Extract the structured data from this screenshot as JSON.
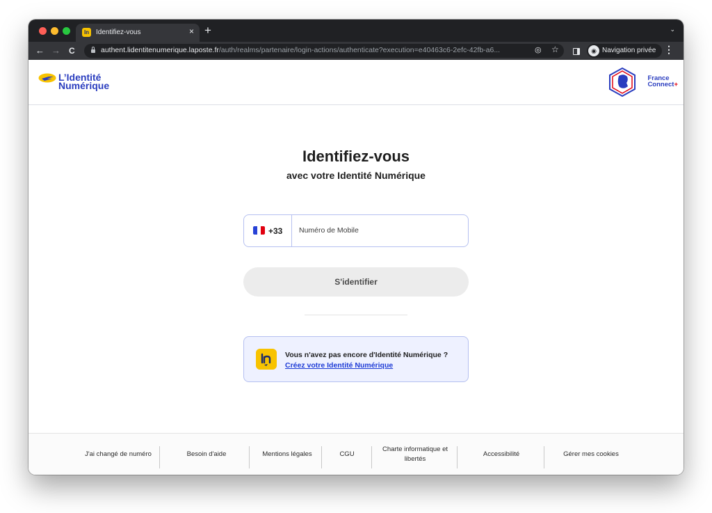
{
  "browser": {
    "tab_title": "Identifiez-vous",
    "tab_favicon": "ln",
    "tab_close": "×",
    "new_tab": "+",
    "tab_menu": "⌄",
    "url_host": "authent.lidentitenumerique.laposte.fr",
    "url_path": "/auth/realms/partenaire/login-actions/authenticate?execution=e40463c6-2efc-42fb-a6...",
    "incognito_label": "Navigation privée",
    "back": "←",
    "forward": "→",
    "reload": "C",
    "eye": "◎",
    "star": "☆",
    "menu": "⋮",
    "incognito_glyph": "◉"
  },
  "header": {
    "brand_line1": "L’Identité",
    "brand_line2": "Numérique",
    "partner_line1": "France",
    "partner_line2": "Connect",
    "partner_plus": "+"
  },
  "main": {
    "title": "Identifiez-vous",
    "subtitle": "avec votre Identité Numérique",
    "dial_code": "+33",
    "phone_placeholder": "Numéro de Mobile",
    "phone_value": "",
    "submit_label": "S'identifier",
    "card_title": "Vous n'avez pas encore d'Identité Numérique ?",
    "card_link": "Créez votre Identité Numérique"
  },
  "footer": {
    "links": [
      "J'ai changé de numéro",
      "Besoin d'aide",
      "Mentions légales",
      "CGU",
      "Charte informatique et libertés",
      "Accessibilité",
      "Gérer mes cookies"
    ]
  },
  "colors": {
    "brand_blue": "#2a3dbf",
    "brand_yellow": "#f8c300",
    "france_red": "#e1000f",
    "chrome_dark": "#202124",
    "chrome_mid": "#35363a"
  }
}
